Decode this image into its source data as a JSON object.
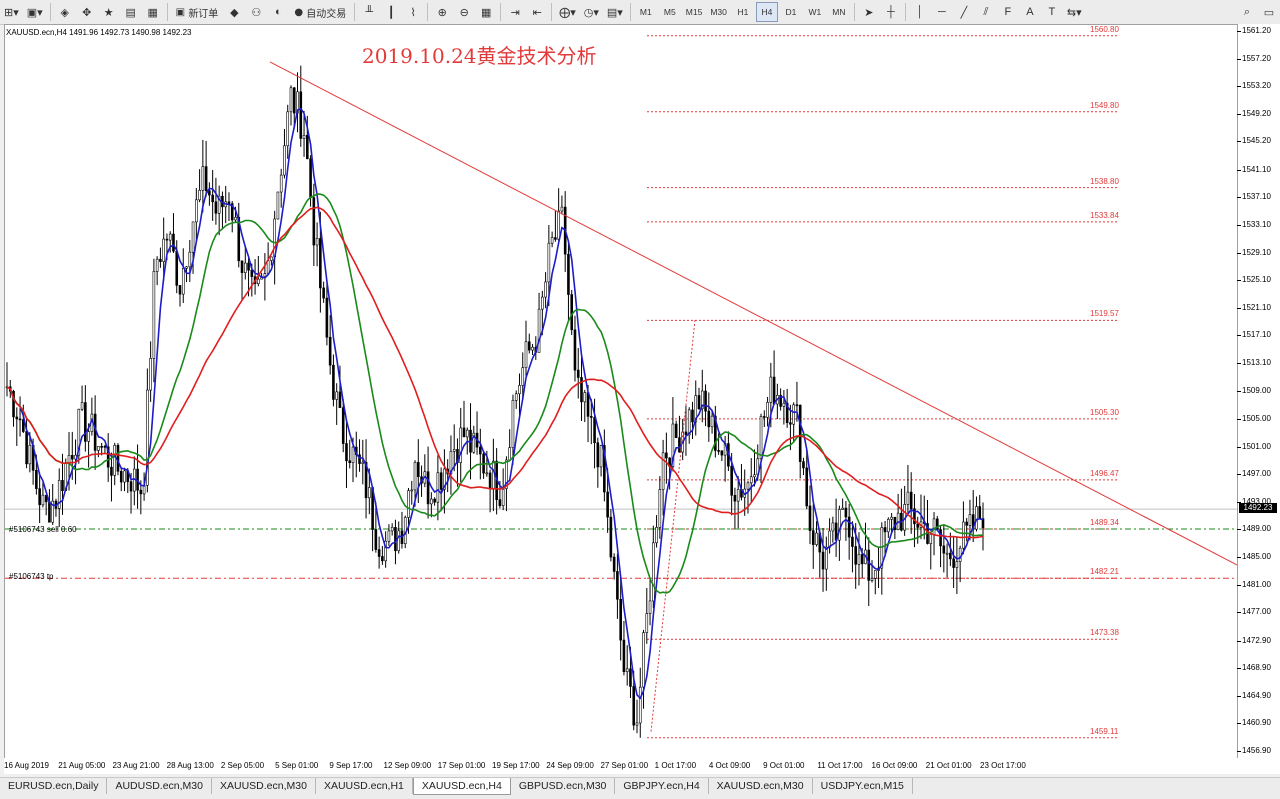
{
  "toolbar": {
    "new_order_label": "新订单",
    "autotrade_label": "自动交易",
    "timeframes": [
      "M1",
      "M5",
      "M15",
      "M30",
      "H1",
      "H4",
      "D1",
      "W1",
      "MN"
    ],
    "active_timeframe": "H4"
  },
  "chart": {
    "symbol_info": "XAUUSD.ecn,H4  1491.96 1492.73 1490.98 1492.23",
    "title": "2019.10.24黄金技术分析",
    "current_price": "1492.23",
    "levels": [
      "1560.80",
      "1549.80",
      "1538.80",
      "1533.84",
      "1519.57",
      "1505.30",
      "1496.47",
      "1489.34",
      "1482.21",
      "1473.38",
      "1459.11"
    ],
    "order_sell_label": "#5106743 sell 0.60",
    "order_tp_label": "#5106743 tp",
    "colors": {
      "level_line": "#e23a3a",
      "ma_fast": "#1c1cc8",
      "ma_mid": "#1a8a1a",
      "ma_slow": "#e01e1e",
      "order_line": "#1a8a1a",
      "tp_line": "#e23a3a"
    }
  },
  "chart_data": {
    "type": "candlestick",
    "price_axis_ticks": [
      "1561.20",
      "1557.20",
      "1553.20",
      "1549.20",
      "1545.20",
      "1541.10",
      "1537.10",
      "1533.10",
      "1529.10",
      "1525.10",
      "1521.10",
      "1517.10",
      "1513.10",
      "1509.00",
      "1505.00",
      "1501.00",
      "1497.00",
      "1493.00",
      "1489.00",
      "1485.00",
      "1481.00",
      "1477.00",
      "1472.90",
      "1468.90",
      "1464.90",
      "1460.90",
      "1456.90"
    ],
    "time_axis_ticks": [
      "16 Aug 2019",
      "21 Aug 05:00",
      "23 Aug 21:00",
      "28 Aug 13:00",
      "2 Sep 05:00",
      "5 Sep 01:00",
      "9 Sep 17:00",
      "12 Sep 09:00",
      "17 Sep 01:00",
      "19 Sep 17:00",
      "24 Sep 09:00",
      "27 Sep 01:00",
      "1 Oct 17:00",
      "4 Oct 09:00",
      "9 Oct 01:00",
      "11 Oct 17:00",
      "16 Oct 09:00",
      "21 Oct 01:00",
      "23 Oct 17:00"
    ],
    "ylim": [
      1456.9,
      1561.2
    ],
    "close_path": [
      1510,
      1506,
      1498,
      1492,
      1494,
      1500,
      1505,
      1503,
      1500,
      1498,
      1497,
      1495,
      1528,
      1532,
      1525,
      1534,
      1540,
      1535,
      1538,
      1528,
      1522,
      1526,
      1540,
      1552,
      1548,
      1530,
      1515,
      1504,
      1500,
      1496,
      1488,
      1487,
      1490,
      1500,
      1495,
      1497,
      1501,
      1503,
      1500,
      1498,
      1495,
      1508,
      1514,
      1518,
      1530,
      1534,
      1510,
      1505,
      1500,
      1484,
      1468,
      1462,
      1480,
      1500,
      1502,
      1505,
      1508,
      1504,
      1500,
      1495,
      1496,
      1504,
      1510,
      1508,
      1505,
      1490,
      1485,
      1488,
      1492,
      1484,
      1483,
      1488,
      1491,
      1492,
      1490,
      1489,
      1485,
      1487,
      1489,
      1492
    ],
    "trendline": {
      "from": {
        "x": "5 Sep 01:00",
        "y": 1557
      },
      "to": {
        "x": "after 23 Oct 17:00",
        "y": 1484
      }
    }
  },
  "tabs": [
    "EURUSD.ecn,Daily",
    "AUDUSD.ecn,M30",
    "XAUUSD.ecn,M30",
    "XAUUSD.ecn,H1",
    "XAUUSD.ecn,H4",
    "GBPUSD.ecn,M30",
    "GBPJPY.ecn,H4",
    "XAUUSD.ecn,M30",
    "USDJPY.ecn,M15"
  ],
  "active_tab": "XAUUSD.ecn,H4"
}
